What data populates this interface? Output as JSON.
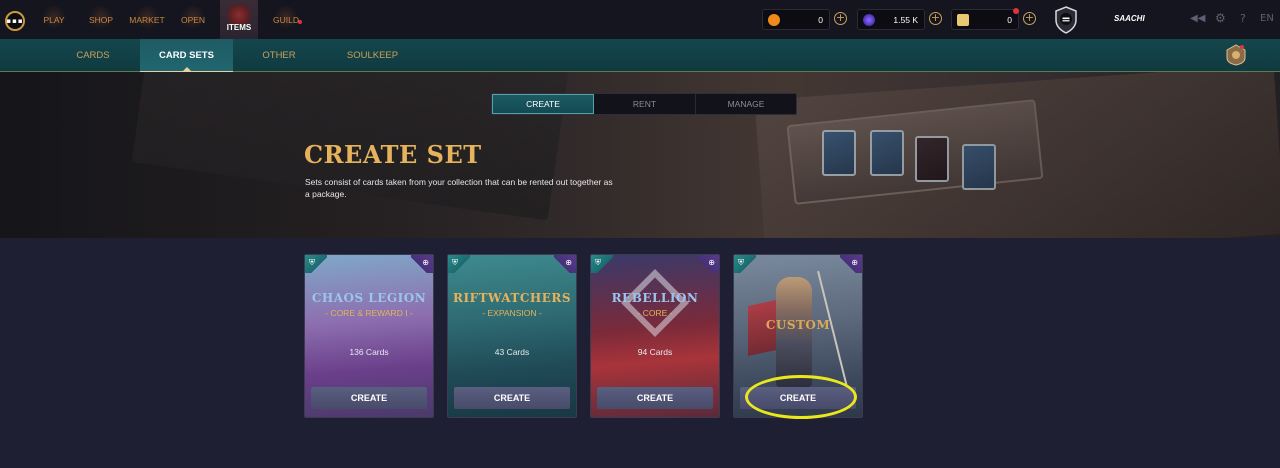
{
  "topnav": {
    "logo_text": "▪▪▪",
    "items": [
      {
        "label": "PLAY",
        "icon": "play-icon"
      },
      {
        "label": "SHOP",
        "icon": "shop-icon"
      },
      {
        "label": "MARKET",
        "icon": "market-icon"
      },
      {
        "label": "OPEN",
        "icon": "open-pack-icon"
      },
      {
        "label": "ITEMS",
        "icon": "items-icon",
        "active": true
      },
      {
        "label": "GUILD",
        "icon": "guild-icon",
        "notification": true
      }
    ]
  },
  "currencies": [
    {
      "name": "credits",
      "value": "0",
      "color": "#f08a1c"
    },
    {
      "name": "dec",
      "value": "1.55 K",
      "color": "#6a4ad8"
    },
    {
      "name": "vouchers",
      "value": "0",
      "color": "#e8c870"
    }
  ],
  "user": {
    "name": "SAACHI"
  },
  "top_icons": {
    "back": "◀◀",
    "settings": "⚙",
    "help": "?",
    "language": "EN"
  },
  "subtabs": [
    {
      "label": "CARDS"
    },
    {
      "label": "CARD SETS",
      "active": true
    },
    {
      "label": "OTHER"
    },
    {
      "label": "SOULKEEP"
    }
  ],
  "mode_tabs": [
    {
      "label": "CREATE",
      "active": true
    },
    {
      "label": "RENT"
    },
    {
      "label": "MANAGE"
    }
  ],
  "hero": {
    "title": "CREATE SET",
    "description": "Sets consist of cards taken from your collection that can be rented out together as a package."
  },
  "sets": [
    {
      "name": "CHAOS LEGION",
      "subtitle": "- CORE & REWARD I -",
      "count": "136 Cards",
      "button": "CREATE",
      "name_color": "#9cc4ee"
    },
    {
      "name": "RIFTWATCHERS",
      "subtitle": "- EXPANSION -",
      "count": "43 Cards",
      "button": "CREATE",
      "name_color": "#e7b25c"
    },
    {
      "name": "REBELLION",
      "subtitle": "- CORE -",
      "count": "94 Cards",
      "button": "CREATE",
      "name_color": "#9cc4ee"
    },
    {
      "name": "CUSTOM",
      "button": "CREATE",
      "name_color": "#d9a85a"
    }
  ],
  "colors": {
    "accent_gold": "#e7b25c",
    "teal_active": "#1f5b62",
    "highlight": "#ece71c"
  }
}
